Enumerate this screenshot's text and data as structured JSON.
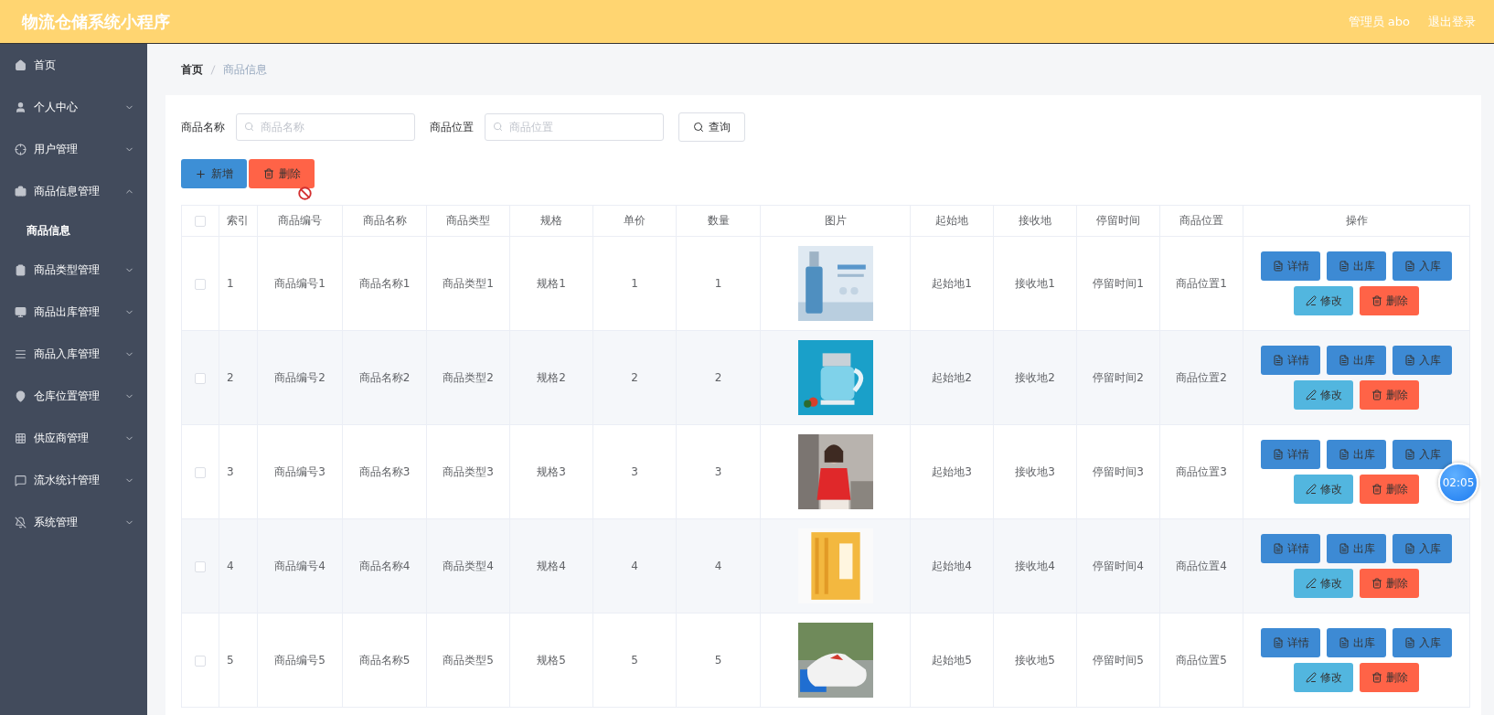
{
  "header": {
    "title": "物流仓储系统小程序",
    "user": "管理员 abo",
    "logout": "退出登录"
  },
  "sidebar": {
    "items": [
      {
        "label": "首页"
      },
      {
        "label": "个人中心",
        "expanded": false
      },
      {
        "label": "用户管理",
        "expanded": false
      },
      {
        "label": "商品信息管理",
        "expanded": true,
        "children": [
          {
            "label": "商品信息",
            "selected": true
          }
        ]
      },
      {
        "label": "商品类型管理",
        "expanded": false
      },
      {
        "label": "商品出库管理",
        "expanded": false
      },
      {
        "label": "商品入库管理",
        "expanded": false
      },
      {
        "label": "仓库位置管理",
        "expanded": false
      },
      {
        "label": "供应商管理",
        "expanded": false
      },
      {
        "label": "流水统计管理",
        "expanded": false
      },
      {
        "label": "系统管理",
        "expanded": false
      }
    ]
  },
  "breadcrumb": [
    "首页",
    "商品信息"
  ],
  "search": {
    "fields": [
      {
        "label": "商品名称",
        "placeholder": "商品名称"
      },
      {
        "label": "商品位置",
        "placeholder": "商品位置"
      }
    ],
    "button": "查询"
  },
  "toolbar": [
    {
      "label": "新增",
      "kind": "add"
    },
    {
      "label": "删除",
      "kind": "delete"
    }
  ],
  "table": {
    "columns": [
      "索引",
      "商品编号",
      "商品名称",
      "商品类型",
      "规格",
      "单价",
      "数量",
      "图片",
      "起始地",
      "接收地",
      "停留时间",
      "商品位置",
      "操作"
    ],
    "all_checked": false,
    "rows": [
      {
        "checked": false,
        "cells": [
          "1",
          "商品编号1",
          "商品名称1",
          "商品类型1",
          "规格1",
          "1",
          "1"
        ],
        "picture": {
          "kind": "picture"
        },
        "cells2": [
          "起始地1",
          "接收地1",
          "停留时间1",
          "商品位置1"
        ],
        "actions": [
          {
            "label": "详情",
            "kind": "detail"
          },
          {
            "label": "出库",
            "kind": "detail"
          },
          {
            "label": "入库",
            "kind": "detail"
          },
          {
            "label": "修改",
            "kind": "edit"
          },
          {
            "label": "删除",
            "kind": "delete"
          }
        ]
      },
      {
        "checked": false,
        "cells": [
          "2",
          "商品编号2",
          "商品名称2",
          "商品类型2",
          "规格2",
          "2",
          "2"
        ],
        "picture": {
          "kind": "picture"
        },
        "cells2": [
          "起始地2",
          "接收地2",
          "停留时间2",
          "商品位置2"
        ],
        "actions": [
          {
            "label": "详情",
            "kind": "detail"
          },
          {
            "label": "出库",
            "kind": "detail"
          },
          {
            "label": "入库",
            "kind": "detail"
          },
          {
            "label": "修改",
            "kind": "edit"
          },
          {
            "label": "删除",
            "kind": "delete"
          }
        ]
      },
      {
        "checked": false,
        "cells": [
          "3",
          "商品编号3",
          "商品名称3",
          "商品类型3",
          "规格3",
          "3",
          "3"
        ],
        "picture": {
          "kind": "picture"
        },
        "cells2": [
          "起始地3",
          "接收地3",
          "停留时间3",
          "商品位置3"
        ],
        "actions": [
          {
            "label": "详情",
            "kind": "detail"
          },
          {
            "label": "出库",
            "kind": "detail"
          },
          {
            "label": "入库",
            "kind": "detail"
          },
          {
            "label": "修改",
            "kind": "edit"
          },
          {
            "label": "删除",
            "kind": "delete"
          }
        ]
      },
      {
        "checked": false,
        "cells": [
          "4",
          "商品编号4",
          "商品名称4",
          "商品类型4",
          "规格4",
          "4",
          "4"
        ],
        "picture": {
          "kind": "picture"
        },
        "cells2": [
          "起始地4",
          "接收地4",
          "停留时间4",
          "商品位置4"
        ],
        "actions": [
          {
            "label": "详情",
            "kind": "detail"
          },
          {
            "label": "出库",
            "kind": "detail"
          },
          {
            "label": "入库",
            "kind": "detail"
          },
          {
            "label": "修改",
            "kind": "edit"
          },
          {
            "label": "删除",
            "kind": "delete"
          }
        ]
      },
      {
        "checked": false,
        "cells": [
          "5",
          "商品编号5",
          "商品名称5",
          "商品类型5",
          "规格5",
          "5",
          "5"
        ],
        "picture": {
          "kind": "picture"
        },
        "cells2": [
          "起始地5",
          "接收地5",
          "停留时间5",
          "商品位置5"
        ],
        "actions": [
          {
            "label": "详情",
            "kind": "detail"
          },
          {
            "label": "出库",
            "kind": "detail"
          },
          {
            "label": "入库",
            "kind": "detail"
          },
          {
            "label": "修改",
            "kind": "edit"
          },
          {
            "label": "删除",
            "kind": "delete"
          }
        ]
      }
    ]
  },
  "timer": "02:05"
}
